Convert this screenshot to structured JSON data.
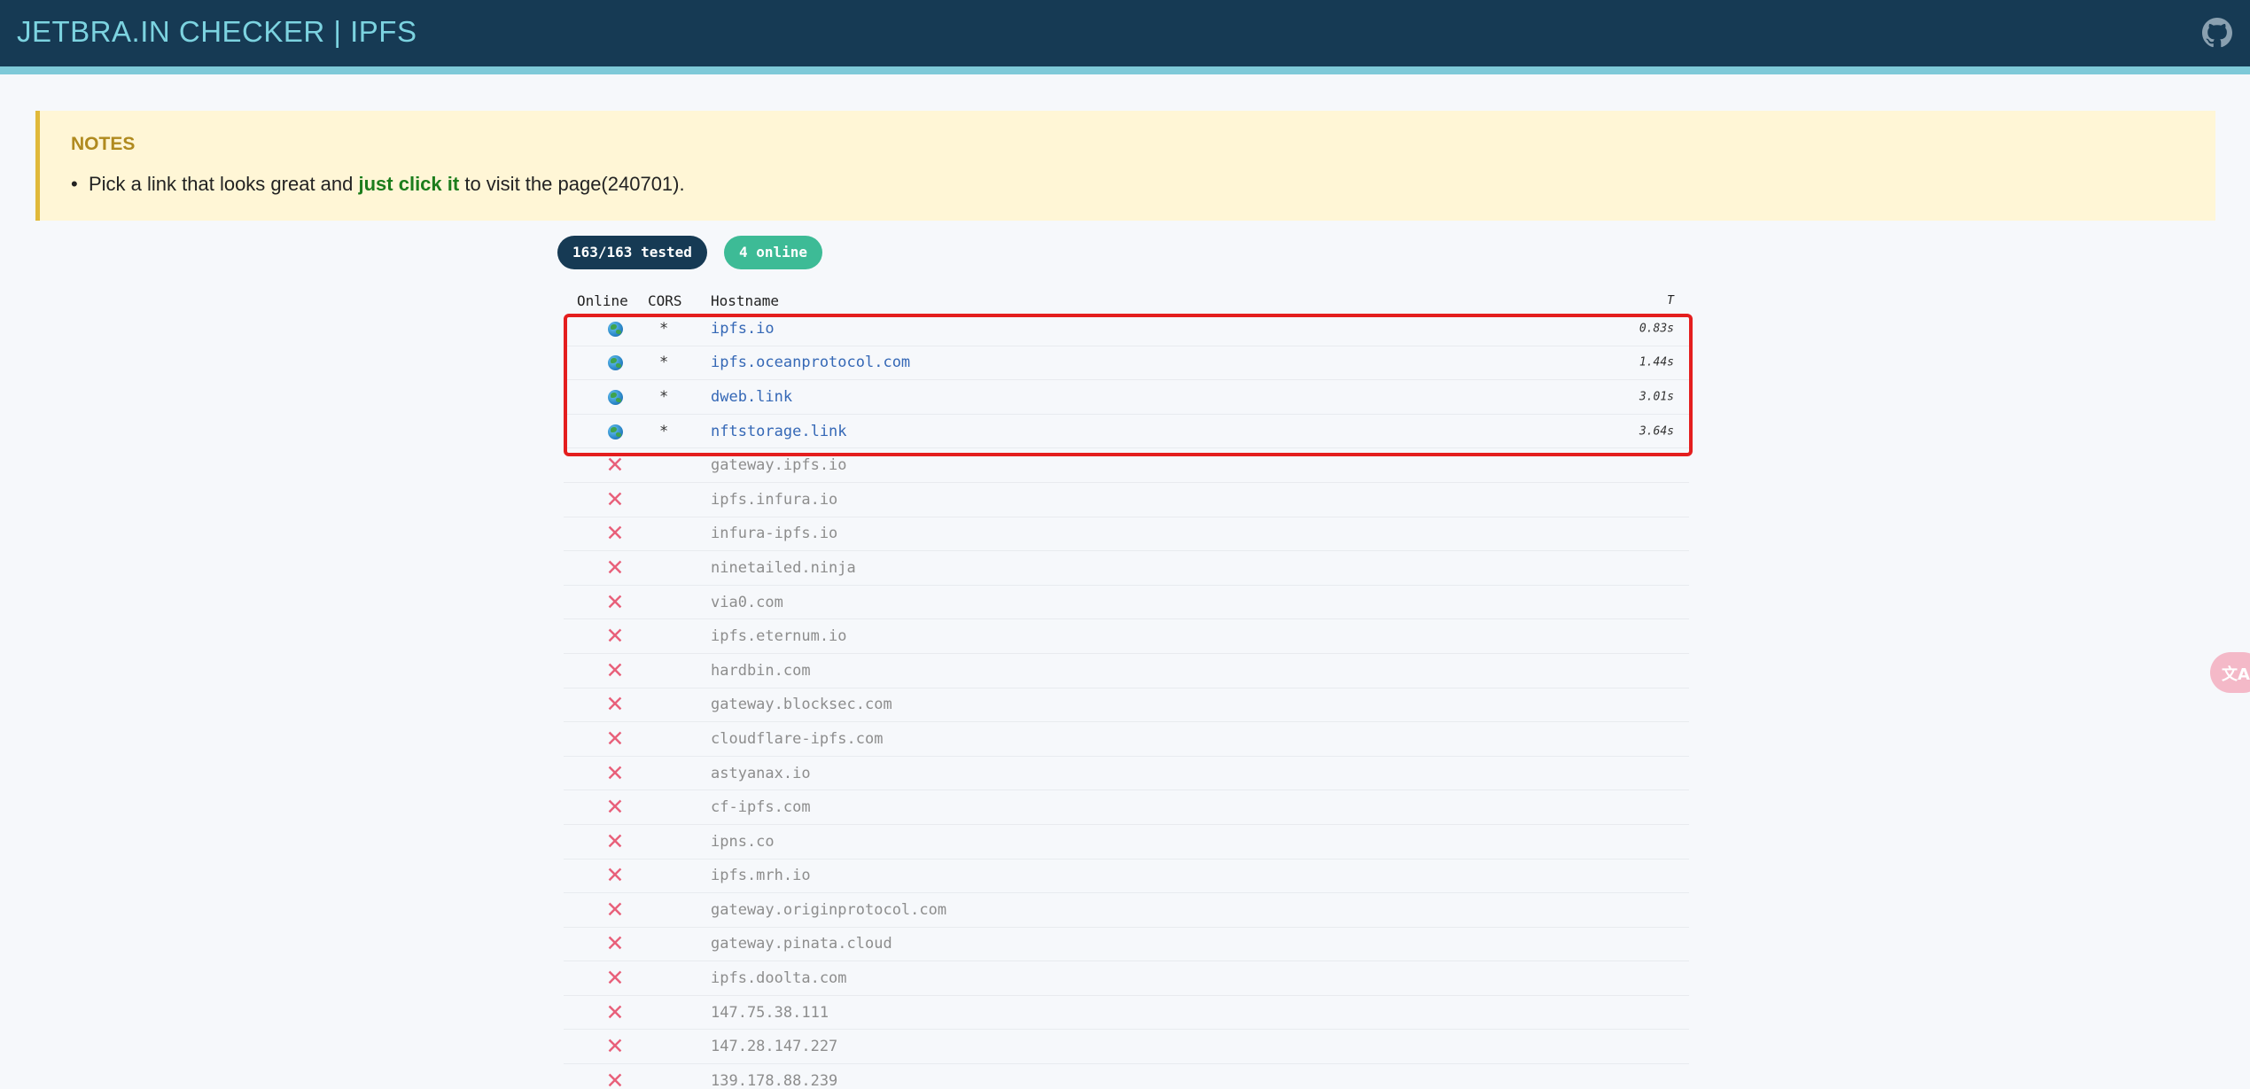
{
  "header": {
    "title": "JETBRA.IN CHECKER | IPFS",
    "github_icon": "github-icon"
  },
  "notes": {
    "title": "NOTES",
    "text_before": "Pick a link that looks great and ",
    "highlight": "just click it",
    "text_after": " to visit the page(240701)."
  },
  "badges": {
    "tested": "163/163 tested",
    "online": "4 online"
  },
  "table": {
    "headers": {
      "online": "Online",
      "cors": "CORS",
      "hostname": "Hostname",
      "time": "T"
    },
    "rows": [
      {
        "status": "online",
        "cors": "*",
        "host": "ipfs.io",
        "time": "0.83s"
      },
      {
        "status": "online",
        "cors": "*",
        "host": "ipfs.oceanprotocol.com",
        "time": "1.44s"
      },
      {
        "status": "online",
        "cors": "*",
        "host": "dweb.link",
        "time": "3.01s"
      },
      {
        "status": "online",
        "cors": "*",
        "host": "nftstorage.link",
        "time": "3.64s"
      },
      {
        "status": "offline",
        "cors": "",
        "host": "gateway.ipfs.io",
        "time": ""
      },
      {
        "status": "offline",
        "cors": "",
        "host": "ipfs.infura.io",
        "time": ""
      },
      {
        "status": "offline",
        "cors": "",
        "host": "infura-ipfs.io",
        "time": ""
      },
      {
        "status": "offline",
        "cors": "",
        "host": "ninetailed.ninja",
        "time": ""
      },
      {
        "status": "offline",
        "cors": "",
        "host": "via0.com",
        "time": ""
      },
      {
        "status": "offline",
        "cors": "",
        "host": "ipfs.eternum.io",
        "time": ""
      },
      {
        "status": "offline",
        "cors": "",
        "host": "hardbin.com",
        "time": ""
      },
      {
        "status": "offline",
        "cors": "",
        "host": "gateway.blocksec.com",
        "time": ""
      },
      {
        "status": "offline",
        "cors": "",
        "host": "cloudflare-ipfs.com",
        "time": ""
      },
      {
        "status": "offline",
        "cors": "",
        "host": "astyanax.io",
        "time": ""
      },
      {
        "status": "offline",
        "cors": "",
        "host": "cf-ipfs.com",
        "time": ""
      },
      {
        "status": "offline",
        "cors": "",
        "host": "ipns.co",
        "time": ""
      },
      {
        "status": "offline",
        "cors": "",
        "host": "ipfs.mrh.io",
        "time": ""
      },
      {
        "status": "offline",
        "cors": "",
        "host": "gateway.originprotocol.com",
        "time": ""
      },
      {
        "status": "offline",
        "cors": "",
        "host": "gateway.pinata.cloud",
        "time": ""
      },
      {
        "status": "offline",
        "cors": "",
        "host": "ipfs.doolta.com",
        "time": ""
      },
      {
        "status": "offline",
        "cors": "",
        "host": "147.75.38.111",
        "time": ""
      },
      {
        "status": "offline",
        "cors": "",
        "host": "147.28.147.227",
        "time": ""
      },
      {
        "status": "offline",
        "cors": "",
        "host": "139.178.88.239",
        "time": ""
      }
    ]
  },
  "translate_widget": {
    "label": "文A"
  },
  "colors": {
    "header_bg": "#163a54",
    "accent": "#7cd3e0",
    "online_badge": "#3dbb96",
    "link": "#3568b6",
    "offline_cross": "#e8607a",
    "highlight_box": "#e41e1e"
  }
}
